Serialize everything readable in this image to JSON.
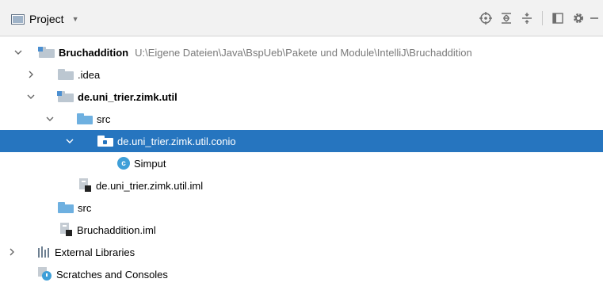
{
  "toolbar": {
    "view_label": "Project",
    "icons": [
      "locate-icon",
      "expand-all-icon",
      "collapse-all-icon",
      "layout-icon",
      "gear-icon",
      "minimize-icon"
    ]
  },
  "tree": {
    "root": {
      "name": "Bruchaddition",
      "path": "U:\\Eigene Dateien\\Java\\BspUeb\\Pakete und Module\\IntelliJ\\Bruchaddition"
    },
    "idea": "idea",
    "module": "de.uni_trier.zimk.util",
    "module_src": "src",
    "package": "de.uni_trier.zimk.util.conio",
    "class_name": "Simput",
    "class_badge": "c",
    "module_iml": "de.uni_trier.zimk.util.iml",
    "root_src": "src",
    "root_iml": "Bruchaddition.iml",
    "external_libraries": "External Libraries",
    "scratches": "Scratches and Consoles"
  },
  "colors": {
    "selection": "#2675bf",
    "toolbar_bg": "#f2f2f2",
    "path_text": "#7a7a7a"
  }
}
